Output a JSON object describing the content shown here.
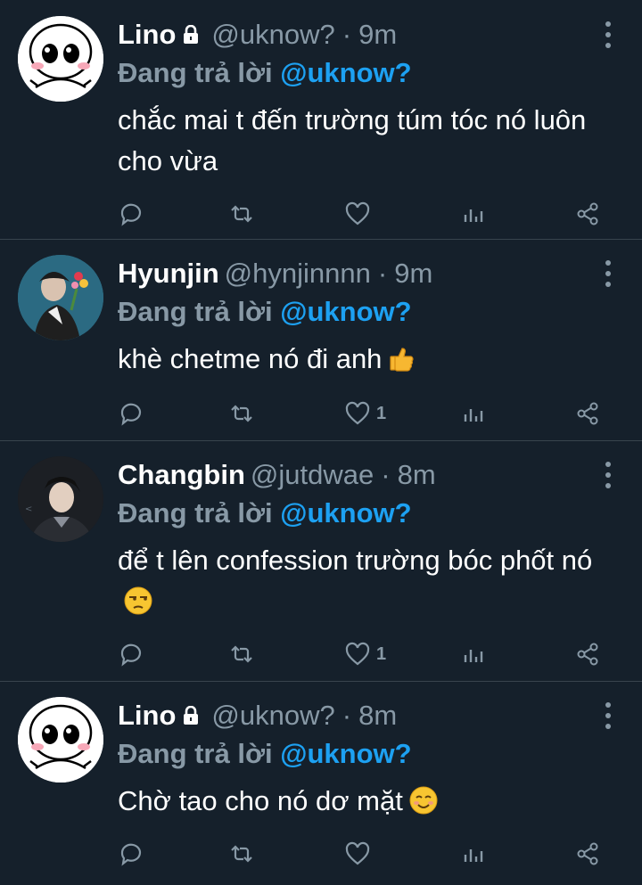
{
  "reply_prefix": "Đang trả lời",
  "tweets": [
    {
      "name": "Lino",
      "locked": true,
      "handle": "@uknow?",
      "separator": "·",
      "time": "9m",
      "replying_to": "@uknow?",
      "text": "chắc mai t đến trường túm tóc nó luôn cho vừa",
      "likes": ""
    },
    {
      "name": "Hyunjin",
      "locked": false,
      "handle": "@hynjinnnn",
      "separator": "·",
      "time": "9m",
      "replying_to": "@uknow?",
      "text": "khè chetme nó đi anh",
      "emoji": "thumbs-up",
      "likes": "1"
    },
    {
      "name": "Changbin",
      "locked": false,
      "handle": "@jutdwae",
      "separator": "·",
      "time": "8m",
      "replying_to": "@uknow?",
      "text": "để t lên confession trường bóc phốt nó",
      "emoji": "unamused-face",
      "likes": "1"
    },
    {
      "name": "Lino",
      "locked": true,
      "handle": "@uknow?",
      "separator": "·",
      "time": "8m",
      "replying_to": "@uknow?",
      "text": "Chờ tao cho nó dơ mặt",
      "emoji": "smiling-face",
      "likes": ""
    }
  ],
  "colors": {
    "background": "#15202b",
    "secondary_text": "#8899a6",
    "mention": "#1da1f2",
    "divider": "#38444d"
  }
}
